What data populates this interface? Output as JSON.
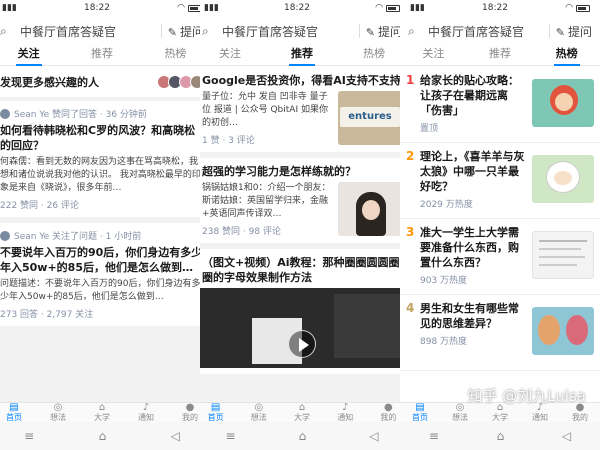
{
  "status": {
    "time": "18:22"
  },
  "search": {
    "placeholder": "中餐厅首席答疑官",
    "ask_label": "提问"
  },
  "tabs": [
    "关注",
    "推荐",
    "热榜"
  ],
  "follow": {
    "discover_label": "发现更多感兴趣的人",
    "items": [
      {
        "meta": "Sean Ye 赞同了回答 · 36 分钟前",
        "title": "如何看待韩晓松和C罗的风波？和高晓松的回应？",
        "excerpt": "何森儒：看到无数的网友因为这事在骂高晓松，我想和诸位说说我对他的认识。 我对高晓松最早的印象是来自《晓说》，很多年前…",
        "stats": "222 赞同 · 26 评论"
      },
      {
        "meta": "Sean Ye 关注了问题 · 1 小时前",
        "title": "不要说年入百万的90后，你们身边有多少年入50w+的85后，他们是怎么做到…",
        "excerpt": "问题描述：不要说年入百万的90后，你们身边有多少年入50w+的85后，他们是怎么做到…",
        "stats": "273 回答 · 2,797 关注"
      }
    ]
  },
  "recommend": {
    "items": [
      {
        "title": "Google是否投资你，得看AI支持不支持",
        "excerpt": "量子位：允中 发自 凹非寺 量子位 报道 | 公众号 QbitAI 如果你的初创…",
        "stats": "1 赞 · 3 评论",
        "thumb_text": "entures"
      },
      {
        "title": "超强的学习能力是怎样练就的？",
        "excerpt": "锅锅姑娘1和0：介绍一个朋友：斯诺姑娘：英国留学归来，金融+英语同声传译双…",
        "stats": "238 赞同 · 98 评论"
      },
      {
        "title": "（图文+视频）Ai教程：那种圈圈圆圆圈圈的字母效果制作方法",
        "excerpt": "",
        "stats": ""
      }
    ]
  },
  "hot": {
    "items": [
      {
        "rank": "1",
        "title": "给家长的贴心攻略：让孩子在暑期远离「伤害」",
        "heat": "置顶"
      },
      {
        "rank": "2",
        "title": "理论上，《喜羊羊与灰太狼》中哪一只羊最好吃？",
        "heat": "2029 万热度"
      },
      {
        "rank": "3",
        "title": "准大一学生上大学需要准备什么东西，购置什么东西？",
        "heat": "903 万热度"
      },
      {
        "rank": "4",
        "title": "男生和女生有哪些常见的思维差异？",
        "heat": "898 万热度"
      }
    ]
  },
  "bottom_nav": [
    "首页",
    "想法",
    "大学",
    "通知",
    "我的"
  ],
  "watermark": "知乎 @刘九Luisa",
  "colors": {
    "accent": "#0084ff",
    "rank1": "#f1403c",
    "rank_other": "#ff9607"
  },
  "icons": {
    "search": "search-icon",
    "ask": "pen-icon",
    "nav": [
      "home-icon",
      "idea-icon",
      "graduation-cap-icon",
      "bell-icon",
      "profile-icon"
    ]
  }
}
